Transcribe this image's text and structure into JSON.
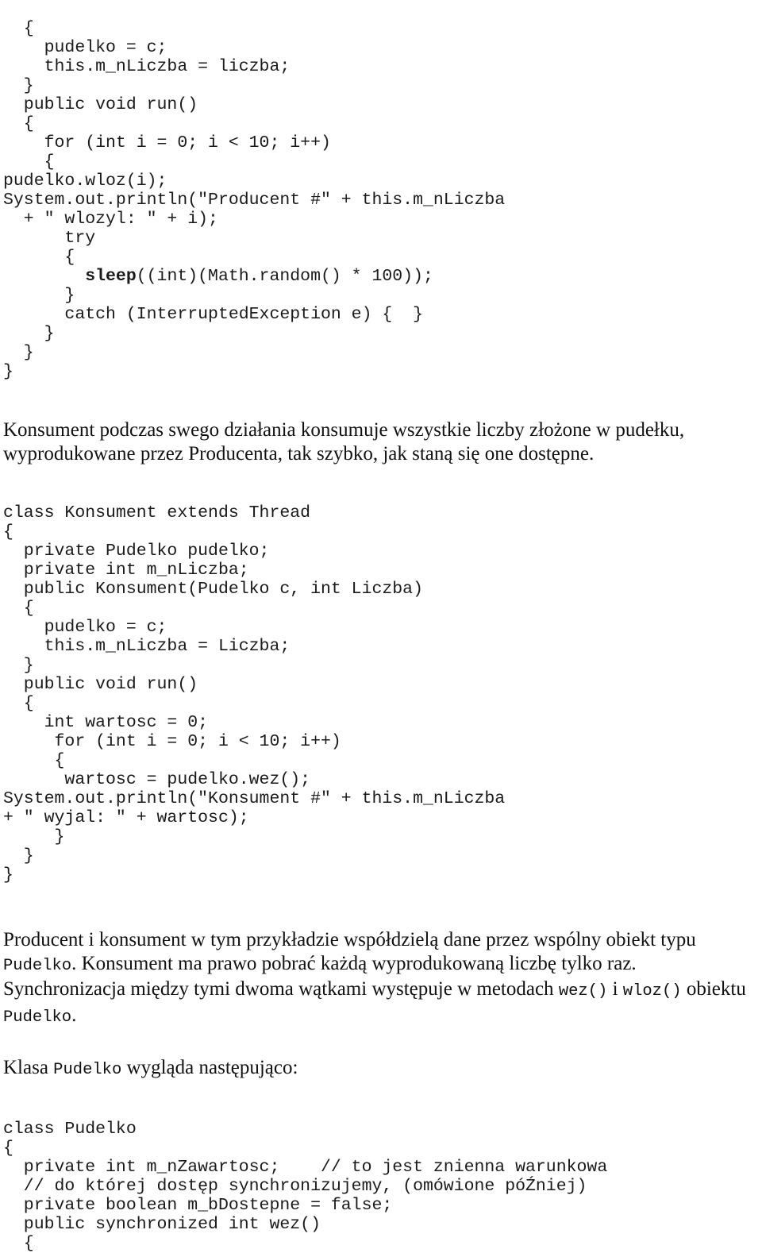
{
  "document": {
    "language": "pl",
    "title": "Producent i Konsument - watki w Javie"
  },
  "blocks": {
    "producer_code_tail": {
      "kind": "code",
      "lines": [
        "  {",
        "    pudelko = c;",
        "    this.m_nLiczba = liczba;",
        "  }",
        "  public void run()",
        "  {",
        "    for (int i = 0; i < 10; i++)",
        "    {",
        "pudelko.wloz(i);",
        "System.out.println(\"Producent #\" + this.m_nLiczba",
        "  + \" wlozyl: \" + i);",
        "      try",
        "      {",
        "        SLEEPBOLD((int)(Math.random() * 100));",
        "      }",
        "      catch (InterruptedException e) {  }",
        "    }",
        "  }",
        "}"
      ],
      "bold_token": "sleep"
    },
    "paragraph_konsument": {
      "kind": "prose",
      "text": "Konsument podczas swego działania konsumuje wszystkie liczby złożone w pudełku, wyprodukowane przez Producenta, tak szybko, jak staną się one dostępne."
    },
    "konsument_code": {
      "kind": "code",
      "lines": [
        "class Konsument extends Thread",
        "{",
        "  private Pudelko pudelko;",
        "  private int m_nLiczba;",
        "  public Konsument(Pudelko c, int Liczba)",
        "  {",
        "    pudelko = c;",
        "    this.m_nLiczba = Liczba;",
        "  }",
        "  public void run()",
        "  {",
        "    int wartosc = 0;",
        "     for (int i = 0; i < 10; i++)",
        "     {",
        "      wartosc = pudelko.wez();",
        "System.out.println(\"Konsument #\" + this.m_nLiczba",
        "+ \" wyjal: \" + wartosc);",
        "     }",
        "  }",
        "}"
      ]
    },
    "paragraph_synchronizacja": {
      "kind": "prose-mixed",
      "runs": [
        {
          "type": "text",
          "value": "Producent i konsument w tym przykładzie współdzielą dane przez wspólny obiekt typu "
        },
        {
          "type": "code",
          "value": "Pudelko"
        },
        {
          "type": "text",
          "value": ". Konsument ma prawo pobrać każdą wyprodukowaną liczbę tylko raz. Synchronizacja między tymi dwoma wątkami występuje w metodach "
        },
        {
          "type": "code",
          "value": "wez()"
        },
        {
          "type": "text",
          "value": " i "
        },
        {
          "type": "code",
          "value": "wloz()"
        },
        {
          "type": "text",
          "value": " obiektu "
        },
        {
          "type": "code",
          "value": "Pudelko"
        },
        {
          "type": "text",
          "value": "."
        }
      ]
    },
    "paragraph_klasa": {
      "kind": "prose-mixed",
      "runs": [
        {
          "type": "text",
          "value": "Klasa "
        },
        {
          "type": "code",
          "value": "Pudelko"
        },
        {
          "type": "text",
          "value": " wygląda następująco:"
        }
      ]
    },
    "pudelko_code": {
      "kind": "code",
      "lines": [
        "class Pudelko",
        "{",
        "  private int m_nZawartosc;    // to jest znienna warunkowa",
        "  // do której dostęp synchronizujemy, (omówione póŹniej)",
        "  private boolean m_bDostepne = false;",
        "  public synchronized int wez()",
        "  {"
      ]
    }
  }
}
